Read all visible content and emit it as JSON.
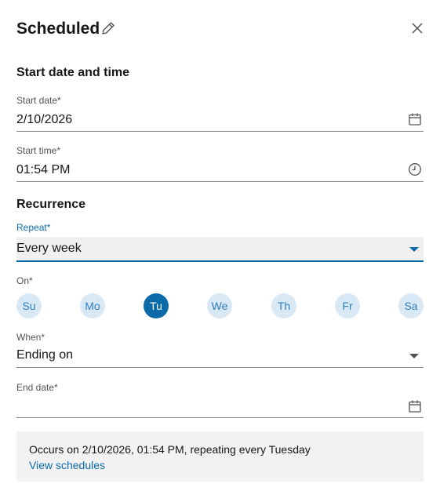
{
  "header": {
    "title": "Scheduled"
  },
  "start_section": {
    "title": "Start date and time",
    "start_date": {
      "label": "Start date",
      "required_mark": "*",
      "value": "2/10/2026"
    },
    "start_time": {
      "label": "Start time",
      "required_mark": "*",
      "value": "01:54 PM"
    }
  },
  "recurrence_section": {
    "title": "Recurrence",
    "repeat": {
      "label": "Repeat",
      "required_mark": "*",
      "value": "Every week"
    },
    "on": {
      "label": "On",
      "required_mark": "*",
      "days": [
        {
          "label": "Su",
          "selected": false
        },
        {
          "label": "Mo",
          "selected": false
        },
        {
          "label": "Tu",
          "selected": true
        },
        {
          "label": "We",
          "selected": false
        },
        {
          "label": "Th",
          "selected": false
        },
        {
          "label": "Fr",
          "selected": false
        },
        {
          "label": "Sa",
          "selected": false
        }
      ]
    },
    "when": {
      "label": "When",
      "required_mark": "*",
      "value": "Ending on"
    },
    "end_date": {
      "label": "End date",
      "required_mark": "*",
      "value": ""
    }
  },
  "summary": {
    "text": "Occurs on 2/10/2026, 01:54 PM, repeating every Tuesday",
    "link": "View schedules"
  },
  "colors": {
    "accent": "#0b6aa8",
    "day_bg": "#d9e8f5",
    "summary_bg": "#f2f2f2"
  },
  "icons": {
    "edit": "pencil-icon",
    "close": "close-icon",
    "calendar": "calendar-icon",
    "clock": "clock-icon",
    "dropdown": "chevron-down-icon"
  }
}
